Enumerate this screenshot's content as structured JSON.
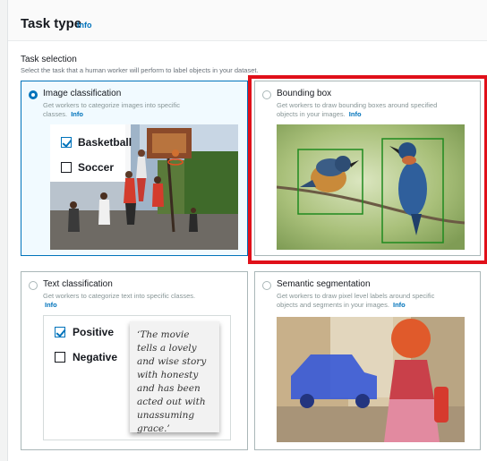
{
  "header": {
    "title": "Task type",
    "info_label": "Info"
  },
  "task_selection": {
    "label": "Task selection",
    "description": "Select the task that a human worker will perform to label objects in your dataset."
  },
  "cards": {
    "image_classification": {
      "name": "Image classification",
      "description": "Get workers to categorize images into specific classes.",
      "info_label": "Info",
      "selected": true,
      "options": [
        {
          "label": "Basketball",
          "checked": true
        },
        {
          "label": "Soccer",
          "checked": false
        }
      ]
    },
    "bounding_box": {
      "name": "Bounding box",
      "description": "Get workers to draw bounding boxes around specified objects in your images.",
      "info_label": "Info",
      "selected": false
    },
    "text_classification": {
      "name": "Text classification",
      "description": "Get workers to categorize text into specific classes.",
      "info_label": "Info",
      "selected": false,
      "options": [
        {
          "label": "Positive",
          "checked": true
        },
        {
          "label": "Negative",
          "checked": false
        }
      ],
      "quote": "‘The movie tells a lovely and wise story with honesty and has been acted out with unassuming grace.’"
    },
    "semantic_segmentation": {
      "name": "Semantic segmentation",
      "description": "Get workers to draw pixel level labels around specific objects and segments in your images.",
      "info_label": "Info",
      "selected": false
    }
  },
  "colors": {
    "accent": "#0073bb",
    "highlight": "#e0101a",
    "bbox": "#1f8a1f",
    "segment_car": "#3b5bd6",
    "segment_person": "#e05a2b"
  }
}
